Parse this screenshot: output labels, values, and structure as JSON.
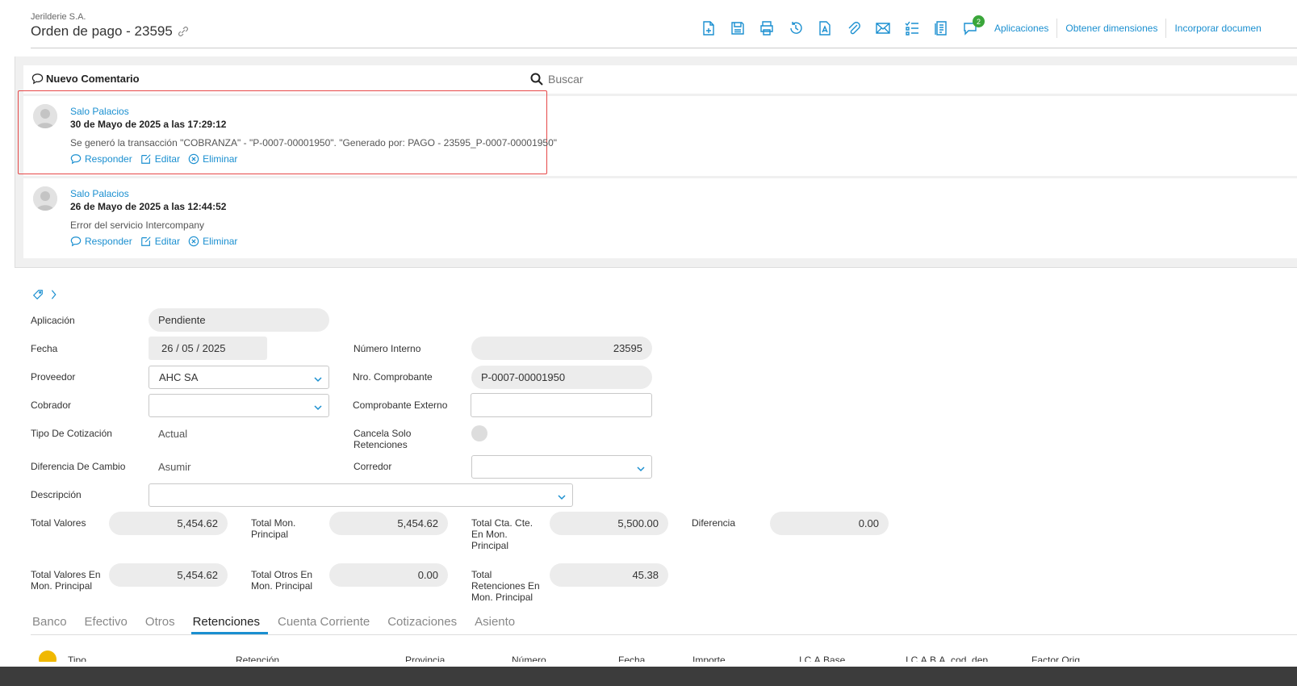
{
  "header": {
    "company": "Jerilderie S.A.",
    "title": "Orden de pago - 23595",
    "toolbar_icons": [
      "new-document-icon",
      "save-icon",
      "print-icon",
      "history-icon",
      "text-document-icon",
      "attachment-icon",
      "email-icon",
      "checklist-icon",
      "report-icon",
      "comments-icon"
    ],
    "comments_badge": "2",
    "links": [
      "Aplicaciones",
      "Obtener dimensiones",
      "Incorporar documen"
    ]
  },
  "comments": {
    "new_comment_label": "Nuevo Comentario",
    "search_placeholder": "Buscar",
    "items": [
      {
        "author": "Salo Palacios",
        "date": "30 de Mayo de 2025 a las 17:29:12",
        "text": "Se generó la transacción \"COBRANZA\" - \"P-0007-00001950\". \"Generado por: PAGO - 23595_P-0007-00001950\"",
        "reply": "Responder",
        "edit": "Editar",
        "delete": "Eliminar"
      },
      {
        "author": "Salo Palacios",
        "date": "26 de Mayo de 2025 a las 12:44:52",
        "text": "Error del servicio Intercompany",
        "reply": "Responder",
        "edit": "Editar",
        "delete": "Eliminar"
      }
    ]
  },
  "form": {
    "aplicacion": {
      "label": "Aplicación",
      "value": "Pendiente"
    },
    "fecha": {
      "label": "Fecha",
      "value": "26 / 05 / 2025"
    },
    "numero_interno": {
      "label": "Número Interno",
      "value": "23595"
    },
    "proveedor": {
      "label": "Proveedor",
      "value": "AHC SA"
    },
    "nro_comprobante": {
      "label": "Nro. Comprobante",
      "value": "P-0007-00001950"
    },
    "cobrador": {
      "label": "Cobrador",
      "value": ""
    },
    "comprobante_externo": {
      "label": "Comprobante Externo",
      "value": ""
    },
    "tipo_cotizacion": {
      "label": "Tipo De Cotización",
      "value": "Actual"
    },
    "cancela_solo_retenciones": {
      "label_line1": "Cancela Solo",
      "label_line2": "Retenciones"
    },
    "diferencia_cambio": {
      "label": "Diferencia De Cambio",
      "value": "Asumir"
    },
    "corredor": {
      "label": "Corredor",
      "value": ""
    },
    "descripcion": {
      "label": "Descripción",
      "value": ""
    }
  },
  "totals": {
    "total_valores": {
      "label": "Total Valores",
      "value": "5,454.62"
    },
    "total_mon_principal": {
      "label_line1": "Total Mon.",
      "label_line2": "Principal",
      "value": "5,454.62"
    },
    "total_cta_cte": {
      "label_line1": "Total Cta. Cte.",
      "label_line2": "En Mon.",
      "label_line3": "Principal",
      "value": "5,500.00"
    },
    "diferencia": {
      "label": "Diferencia",
      "value": "0.00"
    },
    "total_valores_mon": {
      "label_line1": "Total Valores En",
      "label_line2": "Mon. Principal",
      "value": "5,454.62"
    },
    "total_otros": {
      "label_line1": "Total Otros En",
      "label_line2": "Mon. Principal",
      "value": "0.00"
    },
    "total_retenciones": {
      "label_line1": "Total",
      "label_line2": "Retenciones En",
      "label_line3": "Mon. Principal",
      "value": "45.38"
    }
  },
  "tabs": [
    {
      "label": "Banco",
      "active": false
    },
    {
      "label": "Efectivo",
      "active": false
    },
    {
      "label": "Otros",
      "active": false
    },
    {
      "label": "Retenciones",
      "active": true
    },
    {
      "label": "Cuenta Corriente",
      "active": false
    },
    {
      "label": "Cotizaciones",
      "active": false
    },
    {
      "label": "Asiento",
      "active": false
    }
  ],
  "grid_columns": [
    "Tipo",
    "Retención",
    "Provincia",
    "Número",
    "Fecha",
    "Importe",
    "I.C.A.Base",
    "I.C.A.B.A. cod. dep.",
    "Factor Orig."
  ],
  "colors": {
    "accent": "#1a8fd0",
    "highlight": "#e64848",
    "badge": "#3aa63a",
    "field_bg": "#ececec"
  }
}
